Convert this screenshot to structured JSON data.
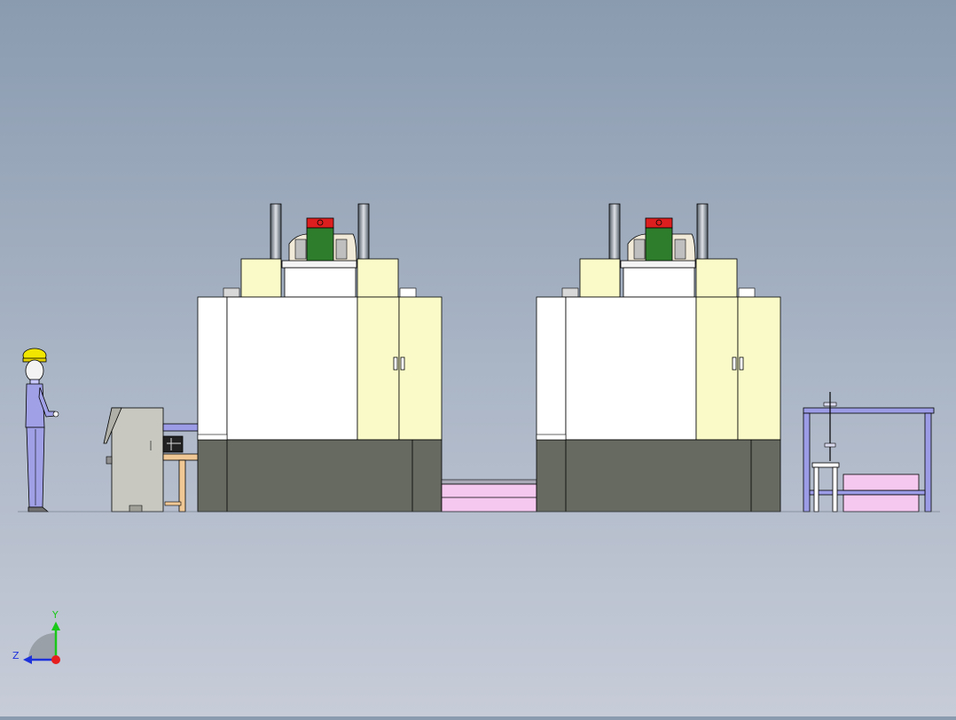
{
  "triad": {
    "y_label": "Y",
    "z_label": "Z"
  },
  "colors": {
    "background_top": "#8a9bb0",
    "background_bottom": "#c7ccd8",
    "machine_base": "#666a60",
    "machine_body": "#ffffff",
    "machine_door": "#fafac8",
    "conveyor": "#f5c8f0",
    "frame": "#9b9be6",
    "table": "#f0c896",
    "cabinet": "#c8c8c0",
    "helmet": "#f0e600",
    "worker_suit": "#a0a0e6",
    "clamp_green": "#2d7d2d",
    "clamp_red": "#dc1e1e",
    "axis_y": "#19c819",
    "axis_z": "#1e32dc",
    "axis_origin": "#e61e1e"
  }
}
